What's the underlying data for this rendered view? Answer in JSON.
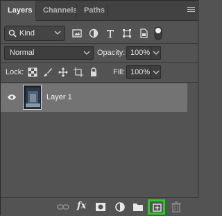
{
  "tabs": {
    "layers": "Layers",
    "channels": "Channels",
    "paths": "Paths"
  },
  "filter": {
    "kind_label": "Kind",
    "icons": [
      "image-filter-icon",
      "adjustment-filter-icon",
      "type-filter-icon",
      "shape-filter-icon",
      "smart-object-filter-icon",
      "filter-toggle-icon"
    ]
  },
  "blend": {
    "mode": "Normal",
    "opacity_label": "Opacity:",
    "opacity_value": "100%"
  },
  "lock": {
    "label": "Lock:",
    "fill_label": "Fill:",
    "fill_value": "100%",
    "icons": [
      "lock-transparent-pixels-icon",
      "lock-image-pixels-icon",
      "lock-position-icon",
      "lock-artboard-icon",
      "lock-all-icon"
    ]
  },
  "layers": [
    {
      "name": "Layer 1",
      "visible": true
    }
  ],
  "footer": {
    "icons": [
      "link-layers-icon",
      "fx-icon",
      "add-mask-icon",
      "adjustment-layer-icon",
      "new-group-icon",
      "new-layer-icon",
      "delete-layer-icon"
    ],
    "fx_label": "fx",
    "highlight_color": "#22d11e"
  },
  "colors": {
    "panel_bg": "#535353",
    "selected_row": "#737373",
    "tab_bar": "#424242"
  }
}
